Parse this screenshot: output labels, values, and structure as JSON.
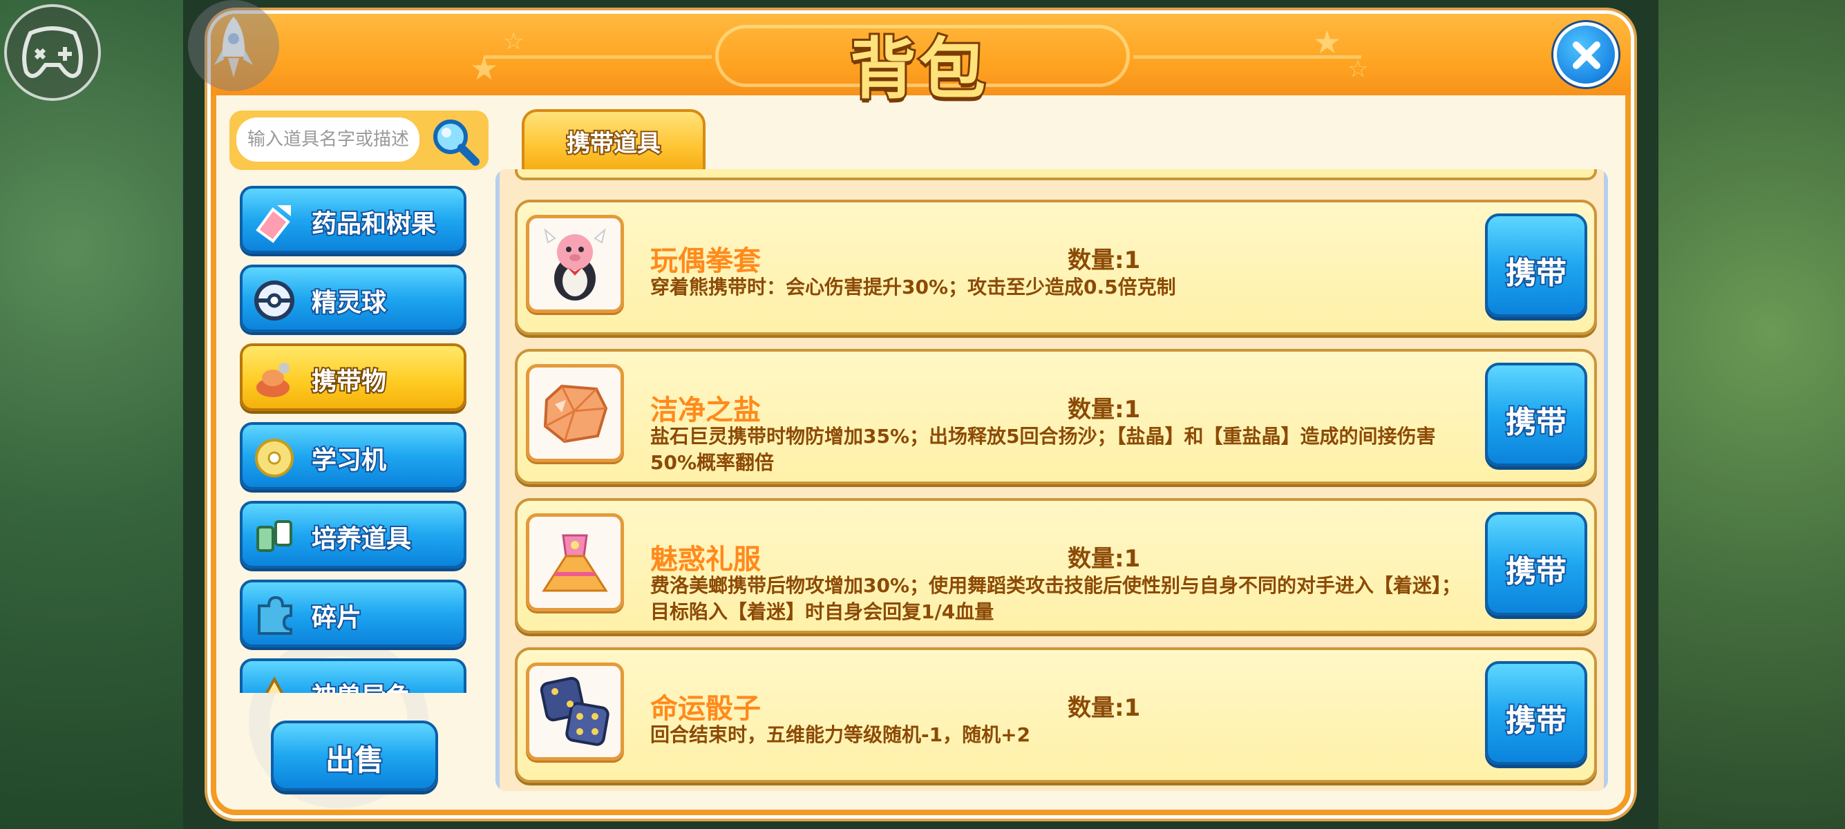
{
  "header": {
    "title": "背包"
  },
  "search": {
    "placeholder": "输入道具名字或描述"
  },
  "categories": [
    {
      "label": "药品和树果",
      "icon": "potion-icon",
      "active": false
    },
    {
      "label": "精灵球",
      "icon": "pokeball-icon",
      "active": false
    },
    {
      "label": "携带物",
      "icon": "held-item-icon",
      "active": true
    },
    {
      "label": "学习机",
      "icon": "disc-icon",
      "active": false
    },
    {
      "label": "培养道具",
      "icon": "training-item-icon",
      "active": false
    },
    {
      "label": "碎片",
      "icon": "puzzle-piece-icon",
      "active": false
    },
    {
      "label": "神兽异色",
      "icon": "legendary-icon",
      "active": false
    }
  ],
  "sell_label": "出售",
  "tab": {
    "label": "携带道具"
  },
  "carry_label": "携带",
  "items": [
    {
      "name": "玩偶拳套",
      "quantity": "数量:1",
      "description": "穿着熊携带时：会心伤害提升30%；攻击至少造成0.5倍克制",
      "icon": "plush-glove-icon"
    },
    {
      "name": "洁净之盐",
      "quantity": "数量:1",
      "description": "盐石巨灵携带时物防增加35%；出场释放5回合扬沙；【盐晶】和【重盐晶】造成的间接伤害50%概率翻倍",
      "icon": "salt-crystal-icon"
    },
    {
      "name": "魅惑礼服",
      "quantity": "数量:1",
      "description": "费洛美螂携带后物攻增加30%；使用舞蹈类攻击技能后使性别与自身不同的对手进入【着迷】；目标陷入【着迷】时自身会回复1/4血量",
      "icon": "dress-icon"
    },
    {
      "name": "命运骰子",
      "quantity": "数量:1",
      "description": "回合结束时，五维能力等级随机-1，随机+2",
      "icon": "dice-icon"
    }
  ]
}
